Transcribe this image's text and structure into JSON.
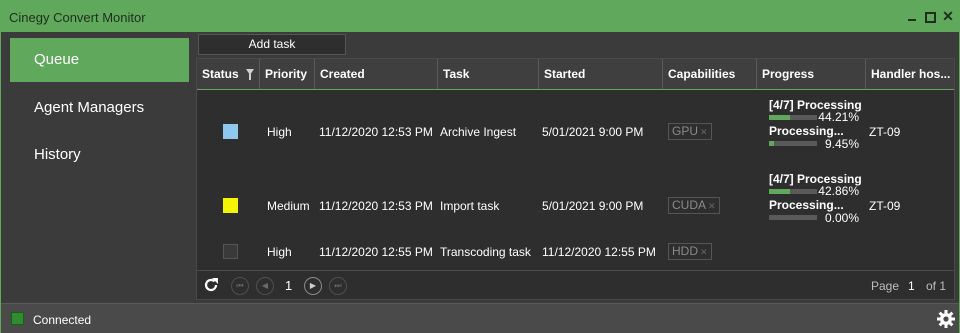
{
  "window": {
    "title": "Cinegy Convert Monitor"
  },
  "sidebar": {
    "items": [
      {
        "label": "Queue",
        "active": true
      },
      {
        "label": "Agent Managers",
        "active": false
      },
      {
        "label": "History",
        "active": false
      }
    ]
  },
  "toolbar": {
    "add_task_label": "Add task"
  },
  "table": {
    "columns": [
      "Status",
      "Priority",
      "Created",
      "Task",
      "Started",
      "Capabilities",
      "Progress",
      "Handler hos..."
    ],
    "rows": [
      {
        "status_color": "#8ec8ee",
        "priority": "High",
        "created": "11/12/2020 12:53 PM",
        "task": "Archive Ingest",
        "started": "5/01/2021 9:00 PM",
        "capability": "GPU",
        "progress": [
          {
            "label": "[4/7] Processing",
            "percent_text": "44.21%",
            "value": 0.4421
          },
          {
            "label": "Processing...",
            "percent_text": "9.45%",
            "value": 0.0945
          }
        ],
        "handler": "ZT-09"
      },
      {
        "status_color": "#f5f500",
        "priority": "Medium",
        "created": "11/12/2020 12:53 PM",
        "task": "Import task",
        "started": "5/01/2021 9:00 PM",
        "capability": "CUDA",
        "progress": [
          {
            "label": "[4/7] Processing",
            "percent_text": "42.86%",
            "value": 0.4286
          },
          {
            "label": "Processing...",
            "percent_text": "0.00%",
            "value": 0.0
          }
        ],
        "handler": "ZT-09"
      },
      {
        "status_color": "#3a3a3a",
        "priority": "High",
        "created": "11/12/2020 12:55 PM",
        "task": "Transcoding task",
        "started": "11/12/2020 12:55 PM",
        "capability": "HDD",
        "progress": [],
        "handler": ""
      }
    ]
  },
  "pager": {
    "current_page": "1",
    "page_label": "Page",
    "page_value": "1",
    "of_label": "of 1"
  },
  "statusbar": {
    "connection_text": "Connected",
    "connection_color": "#2f8c2f"
  },
  "colors": {
    "accent": "#5fa85c",
    "background": "#3b3b3b",
    "grid_background": "#2e2e2e"
  }
}
